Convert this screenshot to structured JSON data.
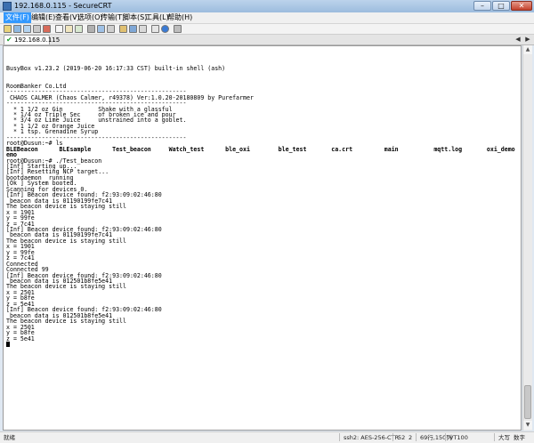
{
  "window": {
    "title": "192.168.0.115 - SecureCRT",
    "min_glyph": "–",
    "max_glyph": "□",
    "close_glyph": "✕"
  },
  "menu": {
    "items": [
      "文件(F)",
      "编辑(E)",
      "查看(V)",
      "选项(O)",
      "传输(T)",
      "脚本(S)",
      "工具(L)",
      "帮助(H)"
    ]
  },
  "tabs": [
    {
      "label": "192.168.0.115",
      "active": true
    }
  ],
  "tabnav": {
    "left": "◀",
    "right": "▶"
  },
  "terminal": {
    "lines": [
      "",
      "",
      "",
      "BusyBox v1.23.2 (2019-06-20 16:17:33 CST) built-in shell (ash)",
      "",
      "",
      "RoomBanker Co.Ltd",
      "---------------------------------------------------",
      " CHAOS CALMER (Chaos Calmer, r49378) Ver:1.0.20-20180809 by Purefarmer",
      "---------------------------------------------------",
      "  * 1 1/2 oz Gin          Shake with a glassful",
      "  * 1/4 oz Triple Sec     of broken ice and pour",
      "  * 3/4 oz Lime Juice     unstrained into a goblet.",
      "  * 1 1/2 oz Orange Juice",
      "  * 1 tsp. Grenadine Syrup",
      "---------------------------------------------------",
      "root@Dusun:~# ls",
      "BLEBeacon      BLEsample      Test_beacon     Watch_test      ble_oxi        ble_test       ca.crt         main          mqtt.log       oxi_demo       test_bt        watch_d",
      "emo",
      "root@Dusun:~# ./Test_beacon",
      "[Inf] Starting up...",
      "[Inf] Resetting NCP target...",
      "bootdaemon  running",
      "[Ok ] System booted.",
      "Scanning for devices 0.",
      "[Inf] Beacon device found: f2:93:09:02:46:80",
      " beacon data is 01190199fe7c41",
      "The beacon device is staying still",
      "x = 1901",
      "y = 99fe",
      "z = 7c41",
      "[Inf] Beacon device found: f2:93:09:02:46:80",
      " beacon data is 01190199fe7c41",
      "The beacon device is staying still",
      "x = 1901",
      "y = 99fe",
      "z = 7c41",
      "Connected",
      "Connected 99",
      "[Inf] Beacon device found: f2:93:09:02:46:80",
      " beacon data is 012501b8fe5e41",
      "The beacon device is staying still",
      "x = 2501",
      "y = b8fe",
      "z = 5e41",
      "[Inf] Beacon device found: f2:93:09:02:46:80",
      " beacon data is 012501b8fe5e41",
      "The beacon device is staying still",
      "x = 2501",
      "y = b8fe",
      "z = 5e41",
      ""
    ],
    "bold_lines": [
      17,
      18
    ]
  },
  "scrollbar": {
    "up": "▲",
    "down": "▼"
  },
  "status": {
    "ready": "就绪",
    "session": "ssh2: AES-256-CTR",
    "row": "52",
    "col": "2",
    "size": "69行,150列",
    "terminal_type": "VT100",
    "caps": "大写",
    "num": "数字"
  }
}
